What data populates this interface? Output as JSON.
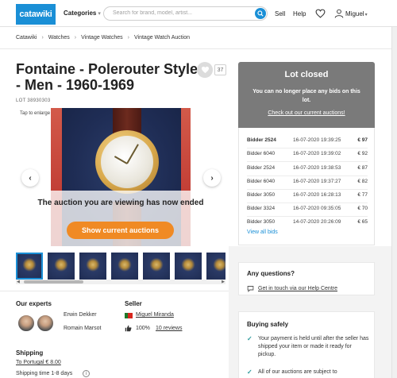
{
  "header": {
    "logo": "catawiki",
    "categories_label": "Categories",
    "search_placeholder": "Search for brand, model, artist...",
    "sell_label": "Sell",
    "help_label": "Help",
    "username": "Miguel"
  },
  "breadcrumb": [
    "Catawiki",
    "Watches",
    "Vintage Watches",
    "Vintage Watch Auction"
  ],
  "lot": {
    "title": "Fontaine - Polerouter Style - Men - 1960-1969",
    "lot_id": "LOT 38930303",
    "favorite_count": "37",
    "tap_to_enlarge": "Tap to enlarge",
    "ended_message": "The auction you are viewing has now ended",
    "show_current_button": "Show current auctions"
  },
  "closed_panel": {
    "title": "Lot closed",
    "subtitle": "You can no longer place any bids on this lot.",
    "link": "Check out our current auctions!"
  },
  "bids": [
    {
      "bidder": "Bidder 2524",
      "date": "16-07-2020 19:39:25",
      "amount": "€ 97"
    },
    {
      "bidder": "Bidder 6040",
      "date": "16-07-2020 19:39:02",
      "amount": "€ 92"
    },
    {
      "bidder": "Bidder 2524",
      "date": "16-07-2020 19:38:53",
      "amount": "€ 87"
    },
    {
      "bidder": "Bidder 6040",
      "date": "16-07-2020 19:37:27",
      "amount": "€ 82"
    },
    {
      "bidder": "Bidder 3050",
      "date": "16-07-2020 16:28:13",
      "amount": "€ 77"
    },
    {
      "bidder": "Bidder 3324",
      "date": "16-07-2020 09:35:05",
      "amount": "€ 70"
    },
    {
      "bidder": "Bidder 3050",
      "date": "14-07-2020 20:26:09",
      "amount": "€ 65"
    }
  ],
  "view_all_bids": "View all bids",
  "questions": {
    "title": "Any questions?",
    "link": "Get in touch via our Help Centre"
  },
  "buying_safely": {
    "title": "Buying safely",
    "items": [
      "Your payment is held until after the seller has shipped your item or made it ready for pickup.",
      "All of our auctions are subject to"
    ]
  },
  "experts": {
    "title": "Our experts",
    "names": [
      "Erwin Dekker",
      "Romain Marsot"
    ]
  },
  "seller": {
    "title": "Seller",
    "name": "Miguel Miranda",
    "rating": "100%",
    "reviews": "10 reviews"
  },
  "shipping": {
    "title": "Shipping",
    "line": "To Portugal € 8.00",
    "time": "Shipping time 1-8 days"
  },
  "colors": {
    "brand_blue": "#1a8fd6",
    "orange": "#f08a24",
    "closed_gray": "#7a7a7a",
    "check_teal": "#2c9a9c"
  }
}
